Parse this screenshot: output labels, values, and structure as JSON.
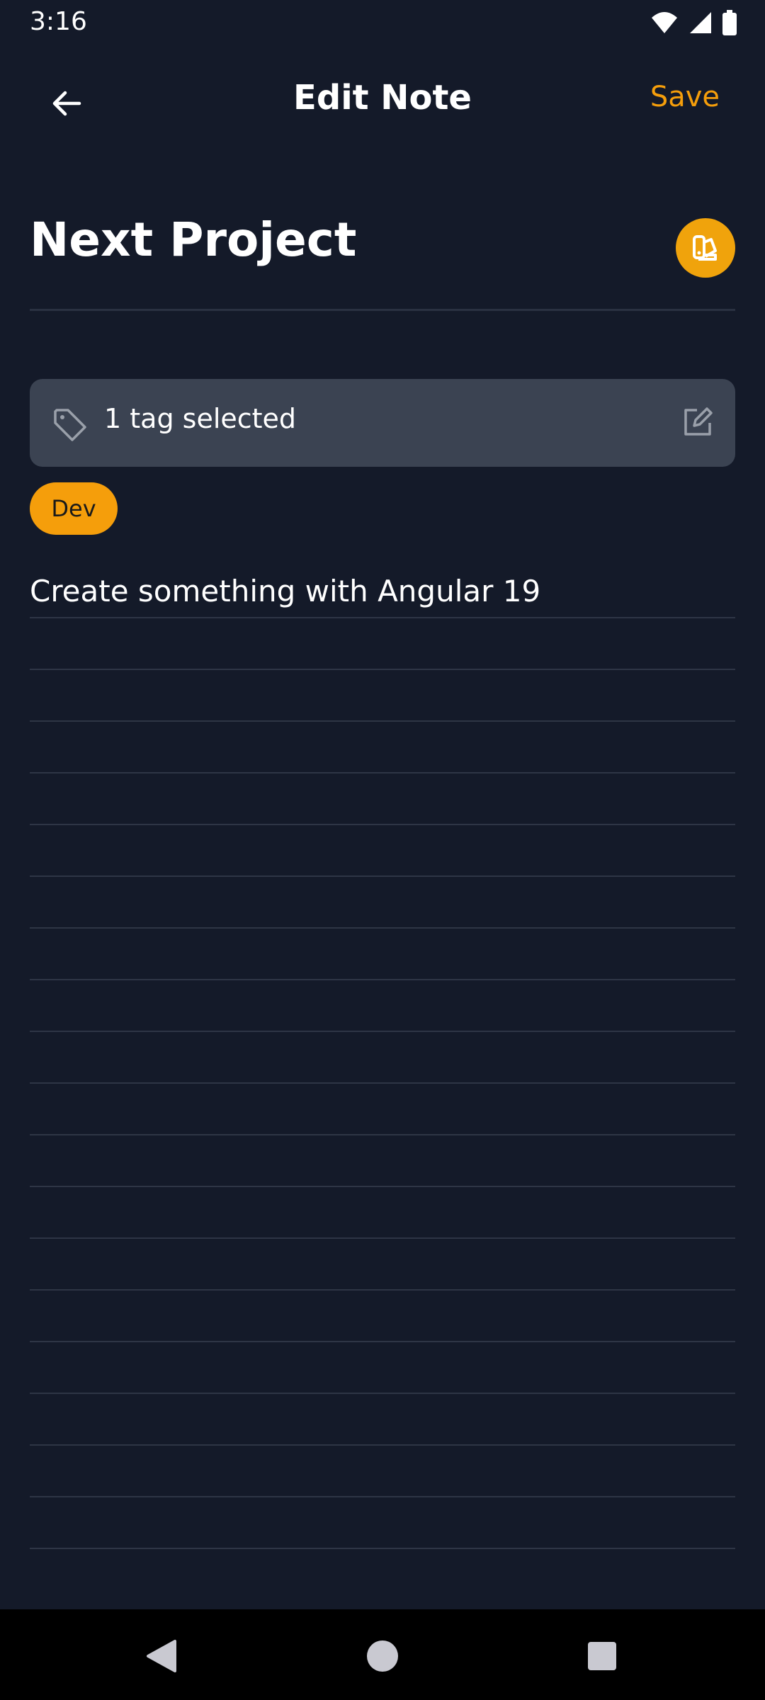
{
  "status_bar": {
    "time": "3:16",
    "icons": [
      "wifi-icon",
      "signal-icon",
      "battery-icon"
    ]
  },
  "header": {
    "title": "Edit Note",
    "save_label": "Save",
    "back_icon": "arrow-left-icon"
  },
  "note": {
    "title": "Next Project",
    "palette_icon": "palette-icon",
    "tag_bar_label": "1 tag selected",
    "tags": [
      {
        "label": "Dev"
      }
    ],
    "content_lines": [
      "Create something with Angular 19",
      "",
      "",
      "",
      "",
      "",
      "",
      "",
      "",
      "",
      "",
      "",
      "",
      "",
      "",
      "",
      "",
      "",
      ""
    ]
  },
  "nav_bar": {
    "icons": [
      "back-triangle-icon",
      "home-circle-icon",
      "recents-square-icon"
    ]
  },
  "colors": {
    "background": "#141a29",
    "accent": "#f59e0b",
    "tag_bar_bg": "#3b4352",
    "line": "#2e3545"
  }
}
